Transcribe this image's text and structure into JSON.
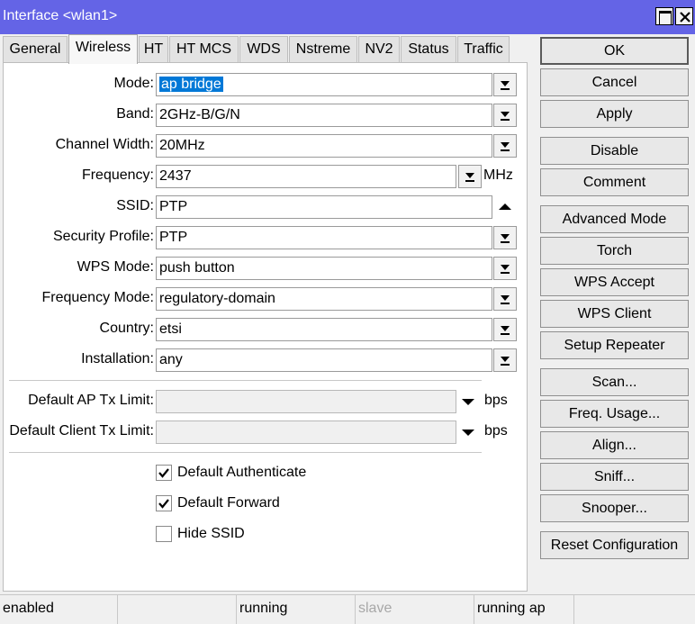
{
  "window": {
    "title": "Interface <wlan1>",
    "titlebar_color": "#6464e6"
  },
  "tabs": [
    {
      "label": "General",
      "active": false
    },
    {
      "label": "Wireless",
      "active": true
    },
    {
      "label": "HT",
      "active": false
    },
    {
      "label": "HT MCS",
      "active": false
    },
    {
      "label": "WDS",
      "active": false
    },
    {
      "label": "Nstreme",
      "active": false
    },
    {
      "label": "NV2",
      "active": false
    },
    {
      "label": "Status",
      "active": false
    },
    {
      "label": "Traffic",
      "active": false
    }
  ],
  "form": {
    "mode": {
      "label": "Mode:",
      "value": "ap bridge"
    },
    "band": {
      "label": "Band:",
      "value": "2GHz-B/G/N"
    },
    "channel_width": {
      "label": "Channel Width:",
      "value": "20MHz"
    },
    "frequency": {
      "label": "Frequency:",
      "value": "2437",
      "unit": "MHz"
    },
    "ssid": {
      "label": "SSID:",
      "value": "PTP"
    },
    "security_profile": {
      "label": "Security Profile:",
      "value": "PTP"
    },
    "wps_mode": {
      "label": "WPS Mode:",
      "value": "push button"
    },
    "frequency_mode": {
      "label": "Frequency Mode:",
      "value": "regulatory-domain"
    },
    "country": {
      "label": "Country:",
      "value": "etsi"
    },
    "installation": {
      "label": "Installation:",
      "value": "any"
    },
    "default_ap_tx_limit": {
      "label": "Default AP Tx Limit:",
      "value": "",
      "unit": "bps"
    },
    "default_client_tx_limit": {
      "label": "Default Client Tx Limit:",
      "value": "",
      "unit": "bps"
    },
    "default_authenticate": {
      "label": "Default Authenticate",
      "checked": true
    },
    "default_forward": {
      "label": "Default Forward",
      "checked": true
    },
    "hide_ssid": {
      "label": "Hide SSID",
      "checked": false
    }
  },
  "buttons": {
    "ok": "OK",
    "cancel": "Cancel",
    "apply": "Apply",
    "disable": "Disable",
    "comment": "Comment",
    "advanced_mode": "Advanced Mode",
    "torch": "Torch",
    "wps_accept": "WPS Accept",
    "wps_client": "WPS Client",
    "setup_repeater": "Setup Repeater",
    "scan": "Scan...",
    "freq_usage": "Freq. Usage...",
    "align": "Align...",
    "sniff": "Sniff...",
    "snooper": "Snooper...",
    "reset_configuration": "Reset Configuration"
  },
  "status_bar": {
    "enabled": "enabled",
    "blank": "",
    "running": "running",
    "slave": "slave",
    "running_ap": "running ap"
  },
  "colors": {
    "selection": "#0078d7"
  }
}
